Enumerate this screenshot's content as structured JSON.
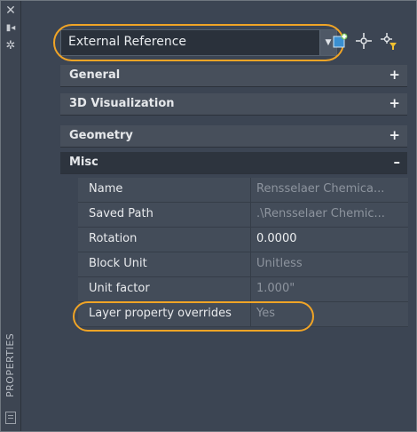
{
  "panel": {
    "vertical_title": "PROPERTIES"
  },
  "toolbar": {
    "object_type": "External Reference",
    "icons": [
      "select-objects-icon",
      "pickadd-icon",
      "quick-select-icon"
    ]
  },
  "sections": [
    {
      "label": "General",
      "state": "+"
    },
    {
      "label": "3D Visualization",
      "state": "+"
    },
    {
      "label": "Geometry",
      "state": "+"
    },
    {
      "label": "Misc",
      "state": "–"
    }
  ],
  "misc_rows": [
    {
      "name": "Name",
      "value": "Rensselaer Chemica..."
    },
    {
      "name": "Saved Path",
      "value": ".\\Rensselaer Chemic..."
    },
    {
      "name": "Rotation",
      "value": "0.0000"
    },
    {
      "name": "Block Unit",
      "value": "Unitless"
    },
    {
      "name": "Unit factor",
      "value": "1.000\""
    },
    {
      "name": "Layer property overrides",
      "value": "Yes"
    }
  ],
  "colors": {
    "highlight": "#f0a426",
    "panel_bg": "#3c4553"
  }
}
